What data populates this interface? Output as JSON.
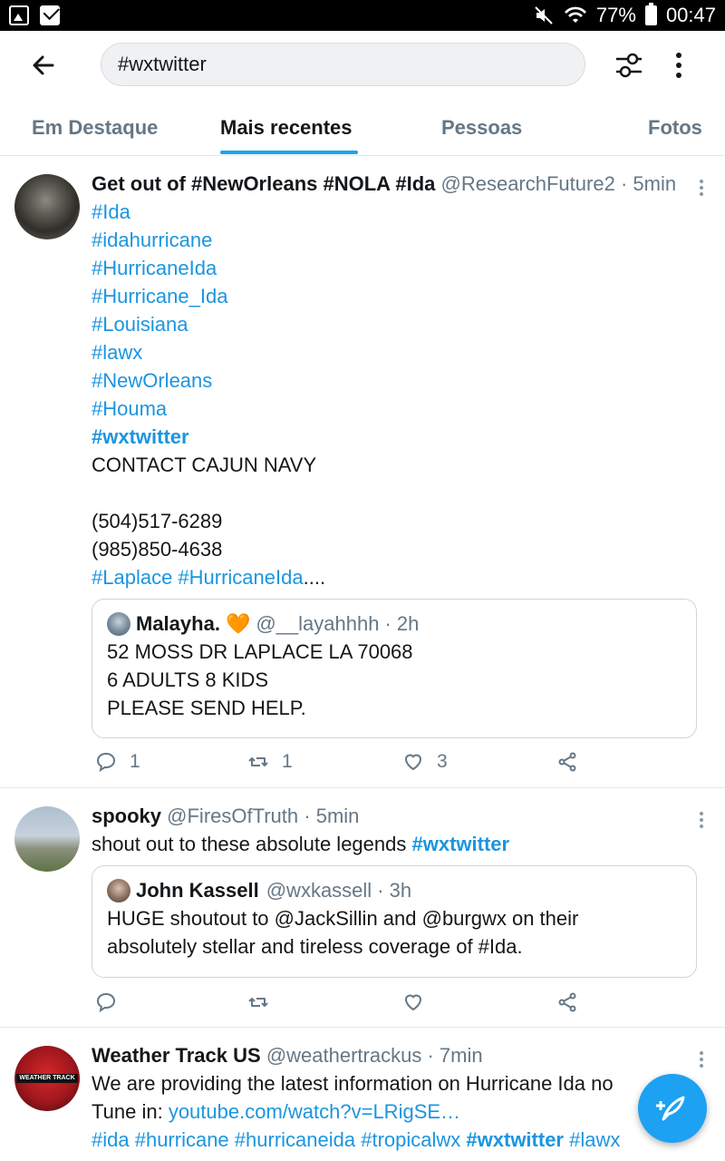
{
  "status_bar": {
    "battery": "77%",
    "time": "00:47"
  },
  "search": {
    "query": "#wxtwitter"
  },
  "tabs": [
    {
      "label": "Em Destaque"
    },
    {
      "label": "Mais recentes"
    },
    {
      "label": "Pessoas"
    },
    {
      "label": "Fotos"
    }
  ],
  "active_tab": "Mais recentes",
  "tweets": [
    {
      "name": "Get out of #NewOrleans #NOLA #Ida",
      "handle": "@ResearchFuture2",
      "time": "· 5min",
      "lines": [
        "#Ida",
        "#idahurricane",
        "#HurricaneIda",
        "#Hurricane_Ida",
        "#Louisiana",
        "#lawx",
        "#NewOrleans",
        "#Houma",
        "#wxtwitter",
        "CONTACT CAJUN NAVY",
        "(504)517-6289",
        "(985)850-4638",
        "#Laplace #HurricaneIda",
        "...."
      ],
      "quote": {
        "name": "Malayha.",
        "emoji": "🧡",
        "handle": "@__layahhhh",
        "time": "· 2h",
        "lines": [
          "52 MOSS DR LAPLACE LA 70068",
          "6 ADULTS 8 KIDS",
          "PLEASE SEND HELP."
        ]
      },
      "counts": {
        "replies": "1",
        "retweets": "1",
        "likes": "3"
      }
    },
    {
      "name": "spooky",
      "handle": "@FiresOfTruth",
      "time": "· 5min",
      "text": "shout out to these absolute legends",
      "hashtag": "#wxtwitter",
      "quote": {
        "name": "John Kassell",
        "handle": "@wxkassell",
        "time": "· 3h",
        "lines": [
          "HUGE shoutout to @JackSillin and @burgwx on their",
          "absolutely stellar and tireless coverage of #Ida."
        ]
      }
    },
    {
      "name": "Weather Track US",
      "handle": "@weathertrackus",
      "time": "· 7min",
      "avatar_text": "WEATHER TRACK",
      "line1": "We are providing the latest information on Hurricane Ida no",
      "tune_in": "Tune in:",
      "link": "youtube.com/watch?v=LRigSE…",
      "tags": [
        "#ida",
        "#hurricane",
        "#hurricaneida",
        "#tropicalwx",
        "#wxtwitter",
        "#lawx"
      ]
    }
  ],
  "colors": {
    "accent": "#1da1f2",
    "link": "#1b95e0",
    "muted": "#657786"
  }
}
